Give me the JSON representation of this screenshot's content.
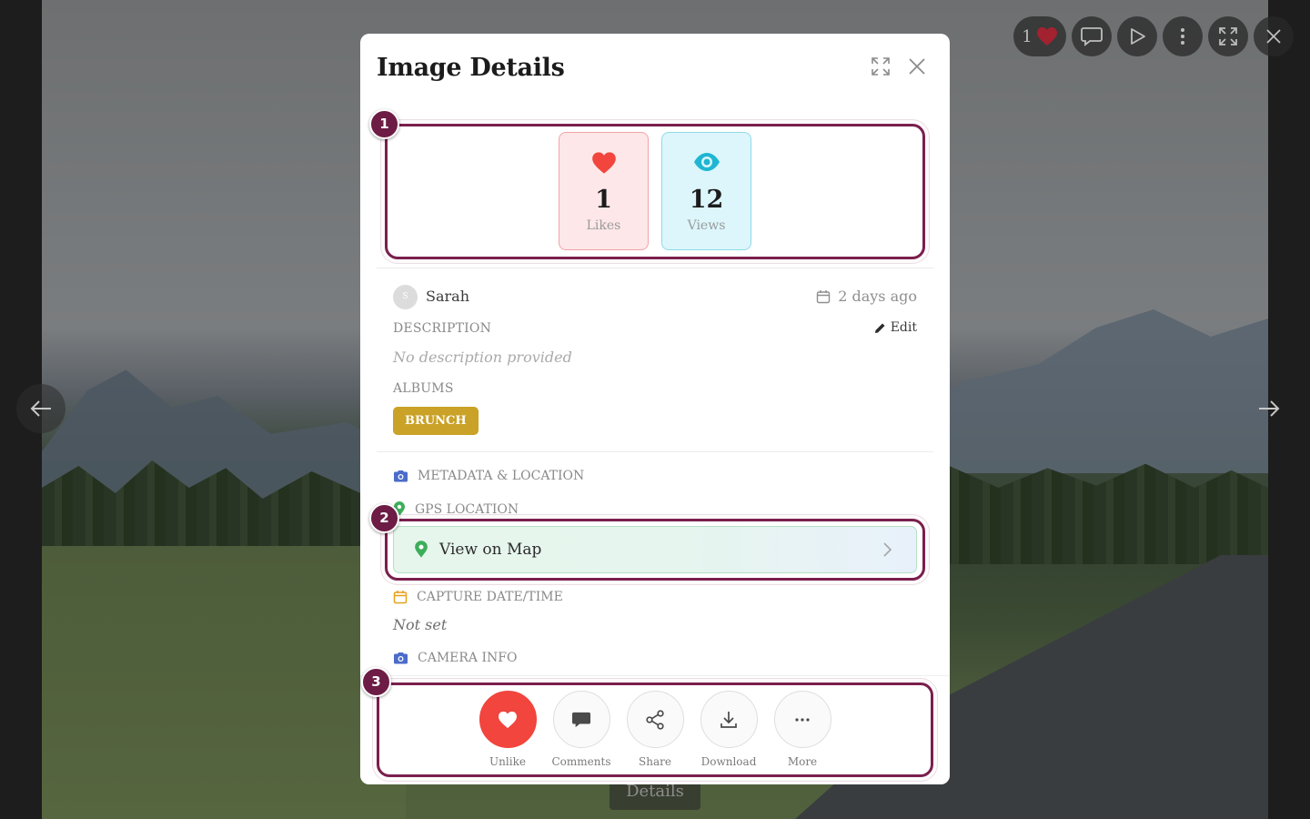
{
  "viewer": {
    "like_count": "1",
    "caption": "Details"
  },
  "modal": {
    "title": "Image Details"
  },
  "stats": {
    "likes": {
      "value": "1",
      "label": "Likes",
      "icon": "heart-icon"
    },
    "views": {
      "value": "12",
      "label": "Views",
      "icon": "eye-icon"
    }
  },
  "info": {
    "avatar_initial": "S",
    "author": "Sarah",
    "date": "2 days ago",
    "description_label": "DESCRIPTION",
    "edit_label": "Edit",
    "description_value": "No description provided",
    "albums_label": "ALBUMS",
    "albums": [
      "BRUNCH"
    ]
  },
  "metadata": {
    "section_label": "METADATA & LOCATION",
    "gps_label": "GPS LOCATION",
    "map_button": "View on Map",
    "capture_label": "CAPTURE DATE/TIME",
    "capture_value": "Not set",
    "camera_label": "CAMERA INFO"
  },
  "actions": [
    {
      "label": "Unlike",
      "icon": "heart-icon"
    },
    {
      "label": "Comments",
      "icon": "comment-icon"
    },
    {
      "label": "Share",
      "icon": "share-icon"
    },
    {
      "label": "Download",
      "icon": "download-icon"
    },
    {
      "label": "More",
      "icon": "more-icon"
    }
  ],
  "annotations": [
    "1",
    "2",
    "3"
  ],
  "colors": {
    "accent_red": "#f1453d",
    "views_cyan": "#1fb6d2",
    "album_gold": "#c9a227",
    "annotation": "#7a1f4d",
    "map_green": "#3cae5a"
  }
}
